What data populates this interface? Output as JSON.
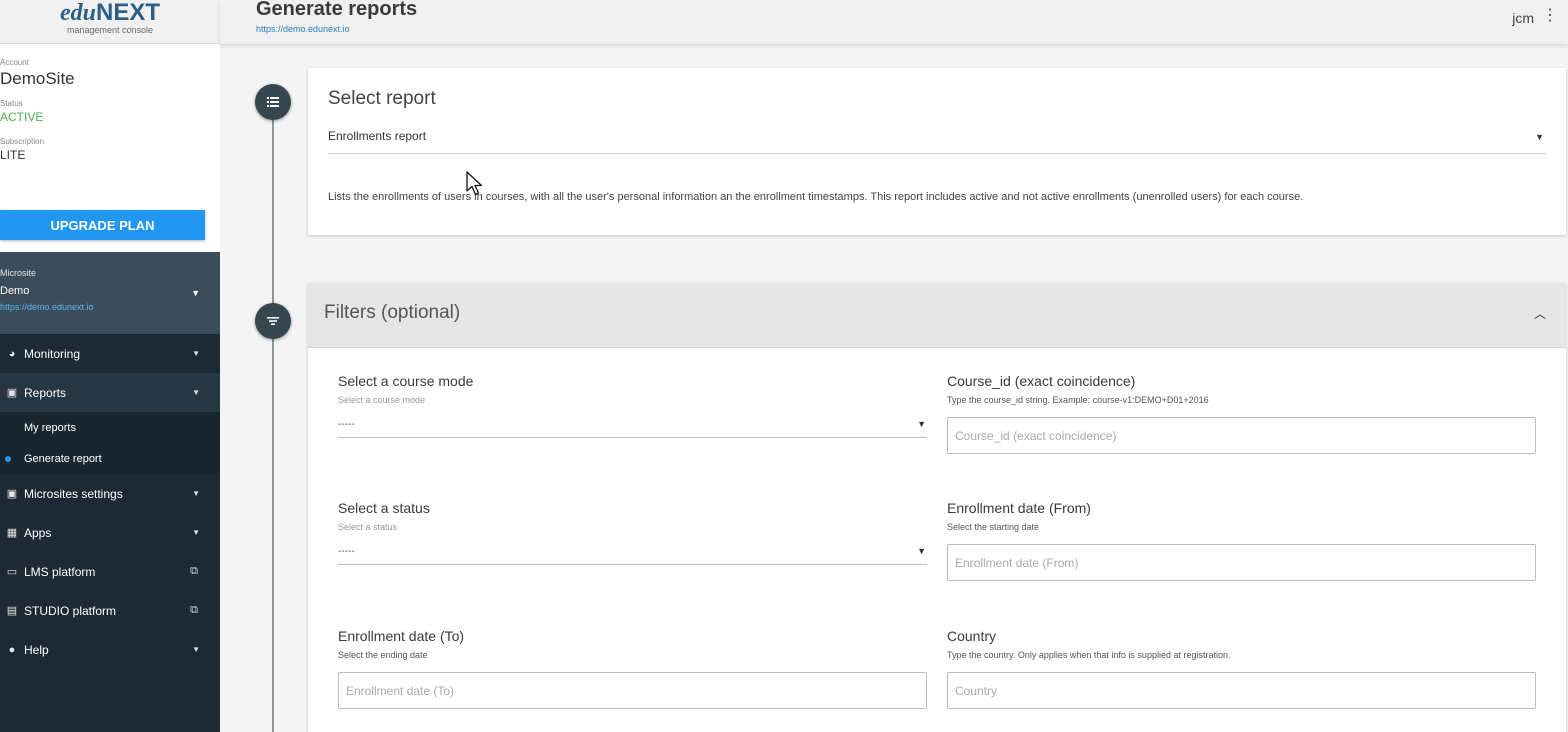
{
  "brand": {
    "name_italic": "edu",
    "name_bold": "NEXT",
    "subtitle": "management console"
  },
  "account": {
    "account_label": "Account",
    "account_value": "DemoSite",
    "status_label": "Status",
    "status_value": "ACTIVE",
    "subscription_label": "Subscription",
    "subscription_value": "LITE",
    "upgrade_label": "UPGRADE PLAN"
  },
  "microsite": {
    "label": "Microsite",
    "value": "Demo",
    "url": "https://demo.edunext.io"
  },
  "nav": {
    "monitoring": "Monitoring",
    "reports": "Reports",
    "my_reports": "My reports",
    "generate_report": "Generate report",
    "microsites_settings": "Microsites settings",
    "apps": "Apps",
    "lms": "LMS platform",
    "studio": "STUDIO platform",
    "help": "Help"
  },
  "header": {
    "title": "Generate reports",
    "url": "https://demo.edunext.io",
    "user": "jcm"
  },
  "select_report": {
    "title": "Select report",
    "selected": "Enrollments report",
    "description": "Lists the enrollments of users in courses, with all the user's personal information an the enrollment timestamps. This report includes active and not active enrollments (unenrolled users) for each course."
  },
  "filters": {
    "title": "Filters (optional)",
    "course_mode": {
      "label": "Select a course mode",
      "hint": "Select a course mode",
      "value": "-----"
    },
    "course_id": {
      "label": "Course_id (exact coincidence)",
      "hint": "Type the course_id string. Example: course-v1:DEMO+D01+2016",
      "placeholder": "Course_id (exact coincidence)"
    },
    "status": {
      "label": "Select a status",
      "hint": "Select a status",
      "value": "-----"
    },
    "date_from": {
      "label": "Enrollment date (From)",
      "hint": "Select the starting date",
      "placeholder": "Enrollment date (From)"
    },
    "date_to": {
      "label": "Enrollment date (To)",
      "hint": "Select the ending date",
      "placeholder": "Enrollment date (To)"
    },
    "country": {
      "label": "Country",
      "hint": "Type the country. Only applies when that info is supplied at registration.",
      "placeholder": "Country"
    }
  },
  "colors": {
    "accent": "#2196f3",
    "sidebar": "#1d2a35",
    "active_status": "#4caf50"
  }
}
